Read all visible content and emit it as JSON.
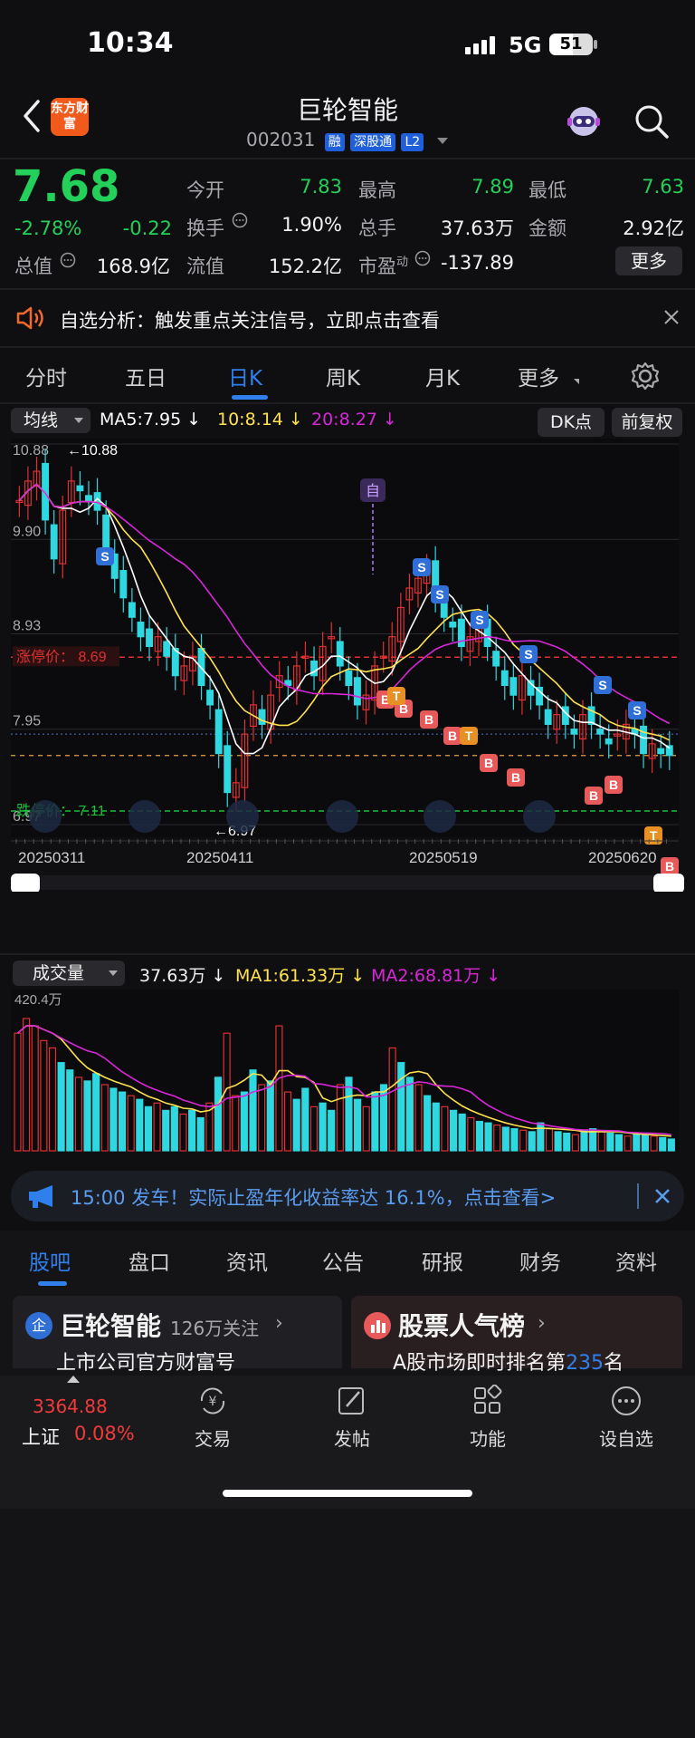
{
  "status": {
    "time": "10:34",
    "network": "5G",
    "battery": "51"
  },
  "header": {
    "title": "巨轮智能",
    "code": "002031",
    "tags": [
      "融",
      "深股通",
      "L2"
    ],
    "logo_text": "东方财富"
  },
  "quote": {
    "price": "7.68",
    "change_pct": "-2.78%",
    "change": "-0.22",
    "open_label": "今开",
    "open": "7.83",
    "high_label": "最高",
    "high": "7.89",
    "low_label": "最低",
    "low": "7.63",
    "turnover_label": "换手",
    "turnover": "1.90%",
    "volume_label": "总手",
    "volume": "37.63万",
    "amount_label": "金额",
    "amount": "2.92亿",
    "total_value_label": "总值",
    "total_value": "168.9亿",
    "float_value_label": "流值",
    "float_value": "152.2亿",
    "pe_label": "市盈",
    "pe_sup": "动",
    "pe": "-137.89",
    "more_label": "更多"
  },
  "alert": {
    "text": "自选分析：触发重点关注信号，立即点击查看"
  },
  "period_tabs": [
    "分时",
    "五日",
    "日K",
    "周K",
    "月K",
    "更多"
  ],
  "active_tab": "日K",
  "ma_bar": {
    "selector": "均线",
    "ma5": "MA5:7.95",
    "ma10": "10:8.14",
    "ma20": "20:8.27",
    "dk": "DK点",
    "fq": "前复权"
  },
  "kline": {
    "price_labels": [
      "10.88",
      "9.90",
      "8.93",
      "7.95",
      "6.97"
    ],
    "high_marker": "←10.88",
    "low_marker": "←6.97",
    "limit_up_label": "涨停价：",
    "limit_up": "8.69",
    "limit_down_label": "跌停价：",
    "limit_down": "7.11",
    "dates": [
      "20250311",
      "20250411",
      "20250519",
      "20250620"
    ],
    "zi_label": "自"
  },
  "volume": {
    "selector": "成交量",
    "vol": "37.63万",
    "ma1": "MA1:61.33万",
    "ma2": "MA2:68.81万",
    "max_label": "420.4万"
  },
  "ad": {
    "text": "15:00 发车！实际止盈年化收益率达 16.1%，点击查看>"
  },
  "bottom_tabs": [
    "股吧",
    "盘口",
    "资讯",
    "公告",
    "研报",
    "财务",
    "资料"
  ],
  "active_bottom_tab": "股吧",
  "cards": [
    {
      "title": "巨轮智能",
      "sub": "126万关注",
      "line": "上市公司官方财富号"
    },
    {
      "title": "股票人气榜",
      "line_pre": "A股市场即时排名第",
      "rank": "235",
      "line_post": "名"
    }
  ],
  "nav": {
    "index_value": "3364.88",
    "index_name": "上证",
    "index_pct": "0.08%",
    "items": [
      "交易",
      "发帖",
      "功能",
      "设自选"
    ]
  },
  "colors": {
    "up": "#f23a3a",
    "down": "#2fd8e0",
    "accent": "#2f80ed",
    "ma5": "#ffffff",
    "ma10": "#ffe14d",
    "ma20": "#d926d9"
  }
}
